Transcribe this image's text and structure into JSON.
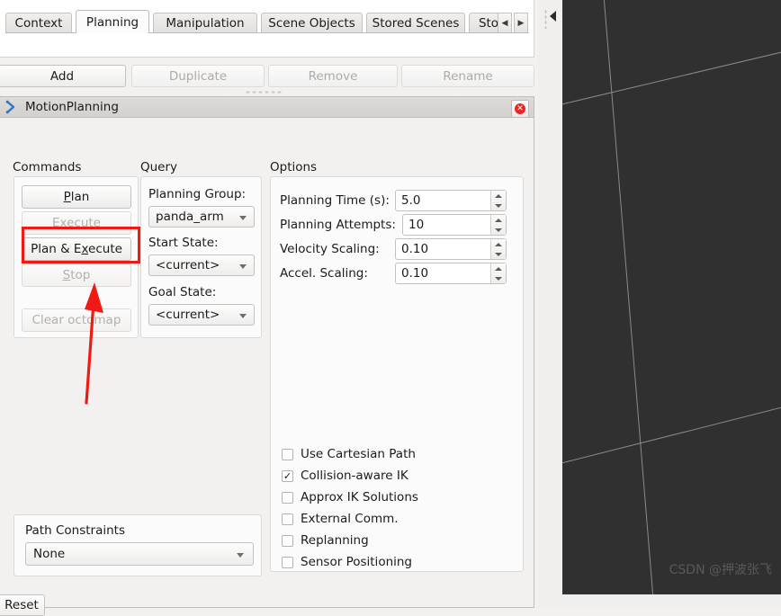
{
  "list_buttons": [
    {
      "label": "Add",
      "enabled": true
    },
    {
      "label": "Duplicate",
      "enabled": false
    },
    {
      "label": "Remove",
      "enabled": false
    },
    {
      "label": "Rename",
      "enabled": false
    }
  ],
  "dock": {
    "title": "MotionPlanning",
    "icon": "rviz-plugin-icon",
    "close_label": "✕"
  },
  "tabs": {
    "items": [
      {
        "label": "Context",
        "active": false
      },
      {
        "label": "Planning",
        "active": true
      },
      {
        "label": "Manipulation",
        "active": false
      },
      {
        "label": "Scene Objects",
        "active": false
      },
      {
        "label": "Stored Scenes",
        "active": false
      },
      {
        "label": "Sto",
        "active": false
      }
    ],
    "scroll_left": "◀",
    "scroll_right": "▶"
  },
  "commands": {
    "title": "Commands",
    "buttons": [
      {
        "label": "Plan",
        "mnemonic": "P",
        "enabled": true
      },
      {
        "label": "Execute",
        "mnemonic": "E",
        "enabled": false
      },
      {
        "label": "Plan & Execute",
        "mnemonic": "x",
        "enabled": true
      },
      {
        "label": "Stop",
        "mnemonic": "S",
        "enabled": false
      },
      {
        "label": "Clear octomap",
        "mnemonic": "",
        "enabled": false
      }
    ]
  },
  "query": {
    "title": "Query",
    "planning_group_label": "Planning Group:",
    "planning_group_value": "panda_arm",
    "start_state_label": "Start State:",
    "start_state_value": "<current>",
    "goal_state_label": "Goal State:",
    "goal_state_value": "<current>"
  },
  "options": {
    "title": "Options",
    "fields": [
      {
        "label": "Planning Time (s):",
        "value": "5.0"
      },
      {
        "label": "Planning Attempts:",
        "value": "10"
      },
      {
        "label": "Velocity Scaling:",
        "value": "0.10"
      },
      {
        "label": "Accel. Scaling:",
        "value": "0.10"
      }
    ],
    "checkboxes": [
      {
        "label": "Use Cartesian Path",
        "checked": false
      },
      {
        "label": "Collision-aware IK",
        "checked": true
      },
      {
        "label": "Approx IK Solutions",
        "checked": false
      },
      {
        "label": "External Comm.",
        "checked": false
      },
      {
        "label": "Replanning",
        "checked": false
      },
      {
        "label": "Sensor Positioning",
        "checked": false
      }
    ],
    "check_glyph": "✓"
  },
  "path_constraints": {
    "title": "Path Constraints",
    "value": "None"
  },
  "reset_button": {
    "label": "Reset"
  },
  "viewport": {
    "watermark": "CSDN @押波张飞",
    "background_color": "#303030",
    "grid_color": "#8a8a8a"
  },
  "annotation": {
    "highlight_color": "#f01a14",
    "target": "Plan & Execute"
  }
}
